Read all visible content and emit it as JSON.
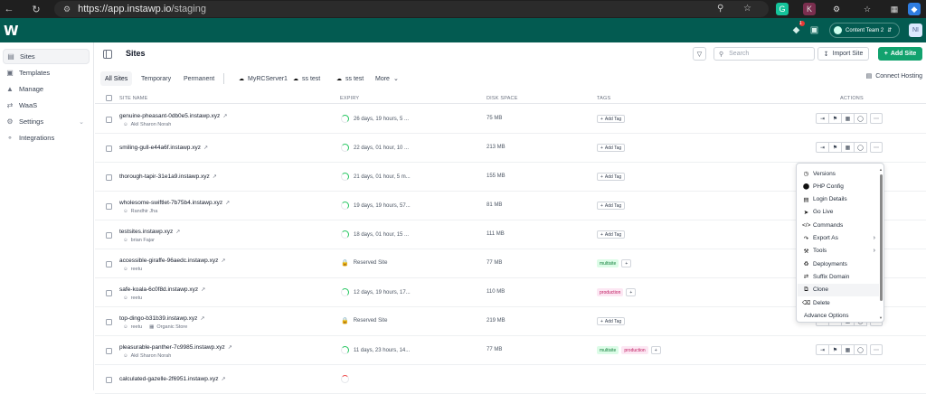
{
  "browser": {
    "url_host": "https://app.instawp.io",
    "url_path": "/staging",
    "extensions": [
      "G",
      "K"
    ]
  },
  "header": {
    "logo": "W",
    "notification_count": "1",
    "team_name": "Content Team 2",
    "avatar_initials": "NI"
  },
  "sidebar": {
    "items": [
      {
        "label": "Sites",
        "icon": "sites-icon"
      },
      {
        "label": "Templates",
        "icon": "templates-icon"
      },
      {
        "label": "Manage",
        "icon": "manage-icon"
      },
      {
        "label": "WaaS",
        "icon": "waas-icon"
      },
      {
        "label": "Settings",
        "icon": "settings-icon"
      },
      {
        "label": "Integrations",
        "icon": "integrations-icon"
      }
    ]
  },
  "page": {
    "title": "Sites",
    "search_placeholder": "Search",
    "import_label": "Import Site",
    "add_label": "Add Site",
    "connect_label": "Connect Hosting"
  },
  "tabs": [
    "All Sites",
    "Temporary",
    "Permanent",
    "MyRCServer1",
    "ss test",
    "ss test",
    "More"
  ],
  "columns": {
    "name": "SITE NAME",
    "expiry": "EXPIRY",
    "disk": "DISK SPACE",
    "tags": "TAGS",
    "actions": "ACTIONS"
  },
  "add_tag_label": "Add Tag",
  "sites": [
    {
      "name": "genuine-pheasant-0db0e5.instawp.xyz",
      "owner": "Akil Sharon Norah",
      "expiry": "26 days, 19 hours, 5 ...",
      "disk": "75 MB",
      "tags": []
    },
    {
      "name": "smiling-gull-e44a6f.instawp.xyz",
      "owner": "",
      "expiry": "22 days, 01 hour, 10 ...",
      "disk": "213 MB",
      "tags": []
    },
    {
      "name": "thorough-tapir-31e1a9.instawp.xyz",
      "owner": "",
      "expiry": "21 days, 01 hour, 5 m...",
      "disk": "155 MB",
      "tags": []
    },
    {
      "name": "wholesome-swiftlet-7b75b4.instawp.xyz",
      "owner": "Randhir Jha",
      "expiry": "19 days, 19 hours, 57...",
      "disk": "81 MB",
      "tags": []
    },
    {
      "name": "testsites.instawp.xyz",
      "owner": "brian Fajar",
      "expiry": "18 days, 01 hour, 15 ...",
      "disk": "111 MB",
      "tags": []
    },
    {
      "name": "accessible-giraffe-96aedc.instawp.xyz",
      "owner": "reetu",
      "expiry": "Reserved Site",
      "disk": "77 MB",
      "tags": [
        "multisite"
      ]
    },
    {
      "name": "safe-koala-6c0f8d.instawp.xyz",
      "owner": "reetu",
      "expiry": "12 days, 19 hours, 17...",
      "disk": "110 MB",
      "tags": [
        "production"
      ]
    },
    {
      "name": "top-dingo-b31b39.instawp.xyz",
      "owner": "reetu",
      "store": "Organic Store",
      "expiry": "Reserved Site",
      "disk": "219 MB",
      "tags": []
    },
    {
      "name": "pleasurable-panther-7c9985.instawp.xyz",
      "owner": "Akil Sharon Norah",
      "expiry": "11 days, 23 hours, 14...",
      "disk": "77 MB",
      "tags": [
        "multisite",
        "production"
      ]
    },
    {
      "name": "calculated-gazelle-2f6951.instawp.xyz",
      "owner": "",
      "expiry": "",
      "disk": "",
      "tags": []
    }
  ],
  "action_menu": [
    {
      "label": "Versions",
      "icon": "clock-icon"
    },
    {
      "label": "PHP Config",
      "icon": "php-icon"
    },
    {
      "label": "Login Details",
      "icon": "document-icon"
    },
    {
      "label": "Go Live",
      "icon": "rocket-icon"
    },
    {
      "label": "Commands",
      "icon": "code-icon"
    },
    {
      "label": "Export As",
      "icon": "export-icon",
      "submenu": true
    },
    {
      "label": "Tools",
      "icon": "tools-icon",
      "submenu": true
    },
    {
      "label": "Deployments",
      "icon": "deploy-icon"
    },
    {
      "label": "Suffix Domain",
      "icon": "link-icon"
    },
    {
      "label": "Clone",
      "icon": "clone-icon"
    },
    {
      "label": "Delete",
      "icon": "trash-icon"
    },
    {
      "label": "Advance Options",
      "icon": ""
    }
  ],
  "colors": {
    "brand_header": "#035b51",
    "primary_button": "#12a26e",
    "tag_multisite_bg": "#dcfce7",
    "tag_production_bg": "#fce7f3"
  }
}
